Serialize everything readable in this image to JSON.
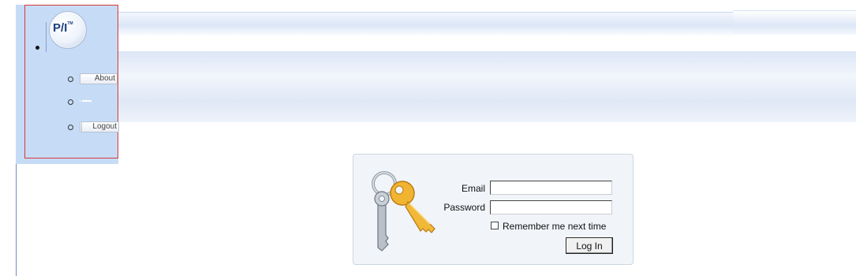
{
  "brand": {
    "logo_text": "P/I",
    "logo_tm": "TM"
  },
  "nav": {
    "items": [
      {
        "label": "About"
      },
      {
        "label": ""
      },
      {
        "label": "Logout"
      }
    ]
  },
  "login": {
    "email_label": "Email",
    "email_value": "",
    "password_label": "Password",
    "password_value": "",
    "remember_label": "Remember me next time",
    "remember_checked": false,
    "submit_label": "Log In",
    "icon": "keys-icon"
  },
  "colors": {
    "side_panel": "#c6dbf5",
    "logo_text": "#1d3f80",
    "highlight_outline": "#d93a3a",
    "login_box_bg": "#f1f5fa"
  }
}
